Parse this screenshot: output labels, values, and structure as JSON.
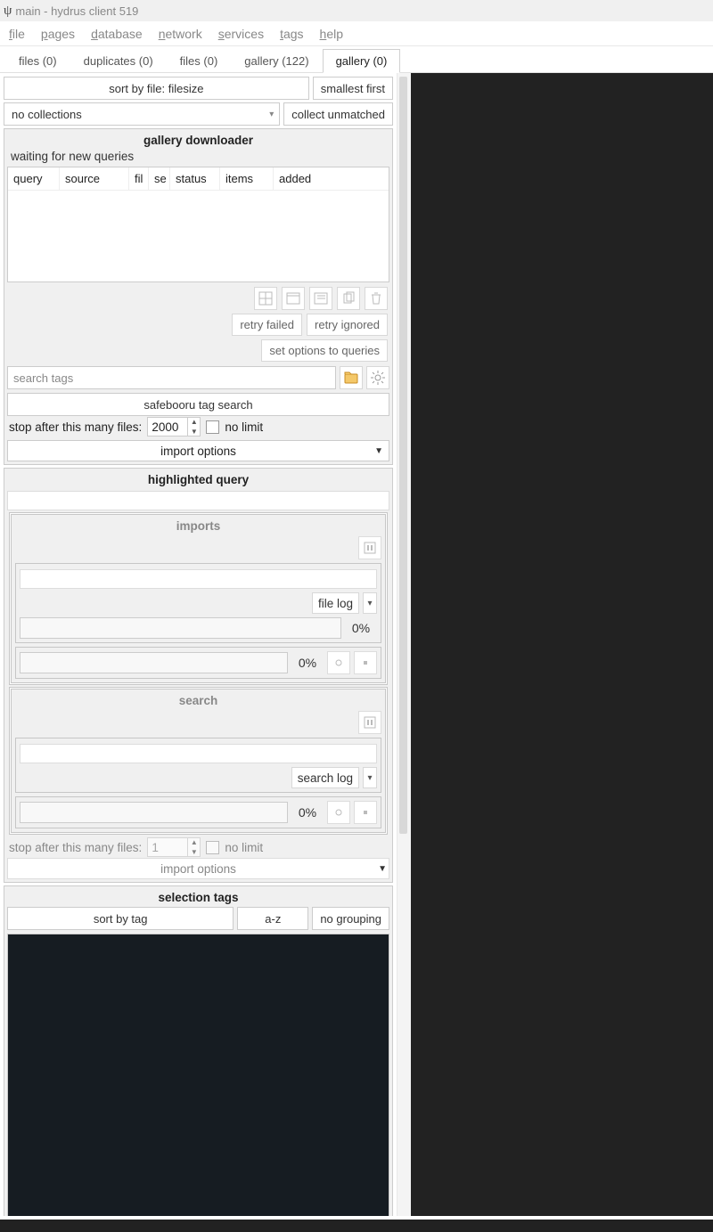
{
  "window": {
    "title": "main - hydrus client 519",
    "icon_char": "ψ"
  },
  "menu": [
    "file",
    "pages",
    "database",
    "network",
    "services",
    "tags",
    "help"
  ],
  "tabs": {
    "items": [
      {
        "label": "files (0)"
      },
      {
        "label": "duplicates (0)"
      },
      {
        "label": "files (0)"
      },
      {
        "label": "gallery (122)"
      },
      {
        "label": "gallery (0)"
      }
    ],
    "active_index": 4
  },
  "sort_bar": {
    "sort_by": "sort by file: filesize",
    "direction": "smallest first",
    "collections": "no collections",
    "collect_unmatched": "collect unmatched"
  },
  "gallery_downloader": {
    "title": "gallery downloader",
    "status": "waiting for new queries",
    "columns": [
      "query",
      "source",
      "fil",
      "se",
      "status",
      "items",
      "added"
    ],
    "retry_failed": "retry failed",
    "retry_ignored": "retry ignored",
    "set_options": "set options to queries",
    "search_placeholder": "search tags",
    "search_engine": "safebooru tag search",
    "stop_after_label": "stop after this many files:",
    "stop_after_value": "2000",
    "no_limit_label": "no limit",
    "import_options": "import options"
  },
  "highlighted": {
    "title": "highlighted query",
    "imports": {
      "title": "imports",
      "file_log_label": "file log",
      "progress1": "0%",
      "progress2": "0%"
    },
    "search": {
      "title": "search",
      "search_log_label": "search log",
      "progress": "0%"
    },
    "stop_after_label": "stop after this many files:",
    "stop_after_value": "1",
    "no_limit_label": "no limit",
    "import_options": "import options"
  },
  "selection_tags": {
    "title": "selection tags",
    "sort_by": "sort by tag",
    "order": "a-z",
    "grouping": "no grouping"
  }
}
